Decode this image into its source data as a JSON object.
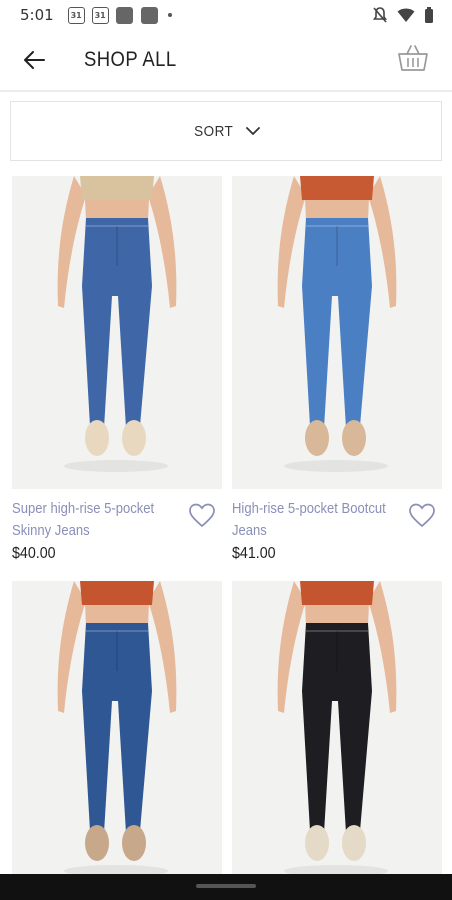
{
  "status": {
    "time": "5:01",
    "cal1": "31",
    "cal2": "31"
  },
  "header": {
    "title": "SHOP ALL"
  },
  "sort": {
    "label": "SORT"
  },
  "products": [
    {
      "title": "Super high-rise 5-pocket Skinny Jeans",
      "price": "$40.00",
      "top_color": "#d8c39e",
      "denim": "#3f67a8",
      "shoe": "#e8d8c0"
    },
    {
      "title": "High-rise 5-pocket Bootcut Jeans",
      "price": "$41.00",
      "top_color": "#c85a33",
      "denim": "#4b7fc4",
      "shoe": "#d8b898"
    },
    {
      "title": "",
      "price": "",
      "top_color": "#c4552f",
      "denim": "#2f5794",
      "shoe": "#c8a88a"
    },
    {
      "title": "",
      "price": "",
      "top_color": "#c4552f",
      "denim": "#1e1e22",
      "shoe": "#e5d9c8"
    }
  ],
  "colors": {
    "title_link": "#8a8fb8",
    "skin": "#e7b99b"
  }
}
